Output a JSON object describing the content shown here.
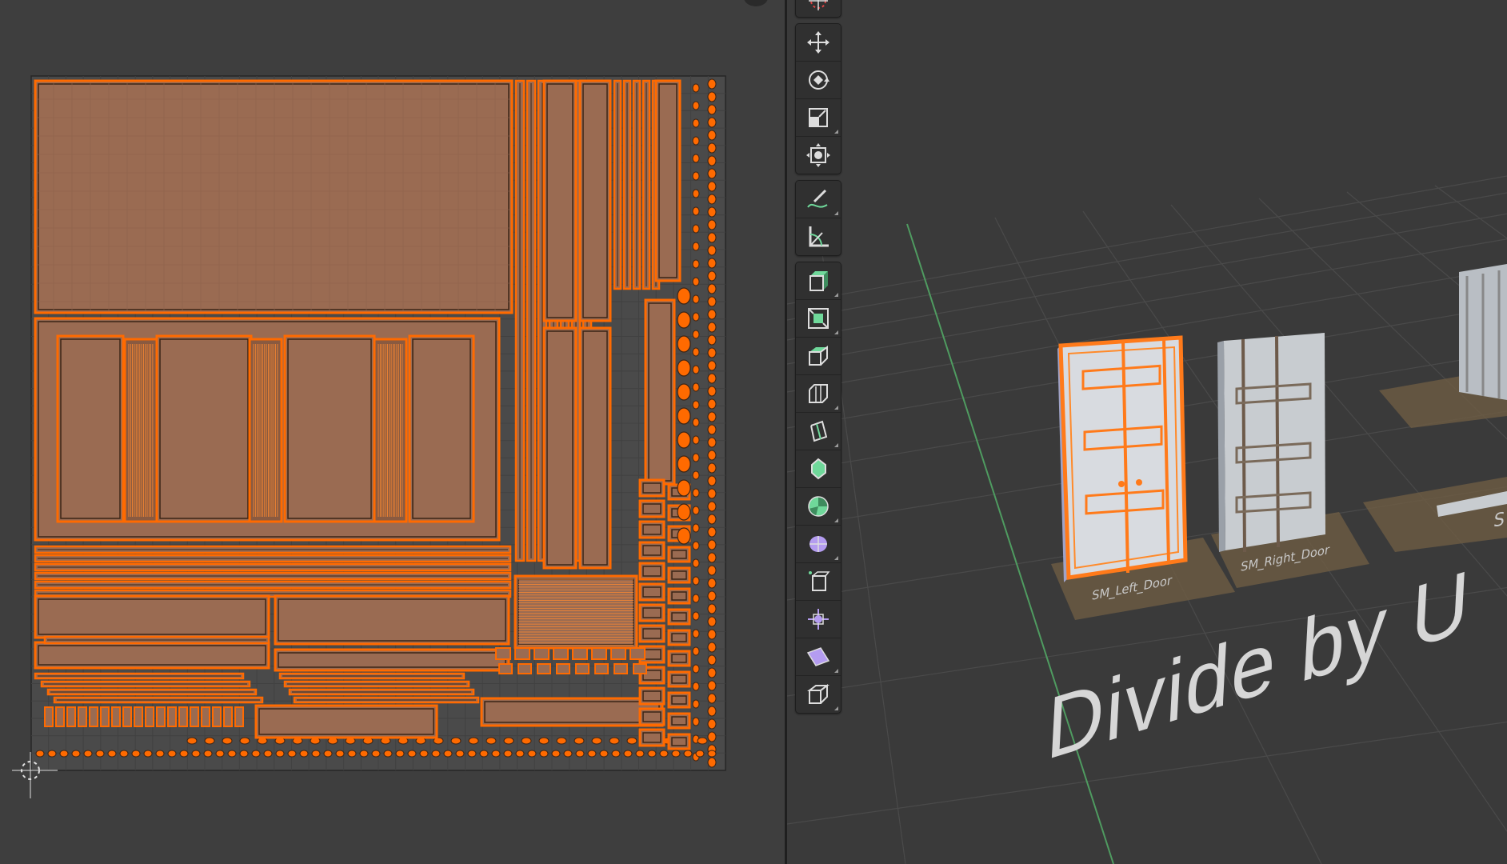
{
  "uv_editor": {
    "name": "UV Editor",
    "grid_color": "#2b2b2b",
    "island_fill": "#9a6b52",
    "island_edge": "#ff6a00",
    "island_dark_edge": "#3a2416",
    "background": "#3e3e3e"
  },
  "toolbar": {
    "groups": [
      [
        {
          "name": "transform-cursor-tool",
          "icon": "cursor-icon"
        }
      ],
      [
        {
          "name": "move-tool",
          "icon": "move-icon"
        },
        {
          "name": "rotate-tool",
          "icon": "rotate-icon"
        },
        {
          "name": "scale-tool",
          "icon": "scale-icon"
        },
        {
          "name": "transform-tool",
          "icon": "transform-icon"
        }
      ],
      [
        {
          "name": "annotate-tool",
          "icon": "annotate-icon"
        },
        {
          "name": "measure-tool",
          "icon": "measure-icon"
        }
      ],
      [
        {
          "name": "add-cube-tool",
          "icon": "add-cube-icon"
        },
        {
          "name": "extrude-region-tool",
          "icon": "extrude-icon"
        },
        {
          "name": "inset-faces-tool",
          "icon": "inset-icon"
        },
        {
          "name": "bevel-tool",
          "icon": "bevel-icon"
        },
        {
          "name": "loop-cut-tool",
          "icon": "loop-cut-icon"
        },
        {
          "name": "knife-tool",
          "icon": "knife-icon"
        },
        {
          "name": "poly-build-tool",
          "icon": "poly-build-icon"
        },
        {
          "name": "spin-tool",
          "icon": "spin-icon"
        },
        {
          "name": "smooth-tool",
          "icon": "smooth-icon"
        },
        {
          "name": "edge-slide-tool",
          "icon": "edge-slide-icon"
        },
        {
          "name": "shrink-fatten-tool",
          "icon": "shrink-fatten-icon"
        },
        {
          "name": "shear-tool",
          "icon": "shear-icon"
        },
        {
          "name": "rip-region-tool",
          "icon": "rip-icon"
        }
      ]
    ]
  },
  "viewport": {
    "name": "3D Viewport",
    "grid_line_color": "#4a4a4a",
    "y_axis_color": "#4d9a5e",
    "selection_color": "#ff7a1a",
    "objects": [
      {
        "label": "SM_Left_Door",
        "selected": true
      },
      {
        "label": "SM_Right_Door",
        "selected": false
      }
    ],
    "floor_text": "Divide by U",
    "partial_label": "S"
  }
}
